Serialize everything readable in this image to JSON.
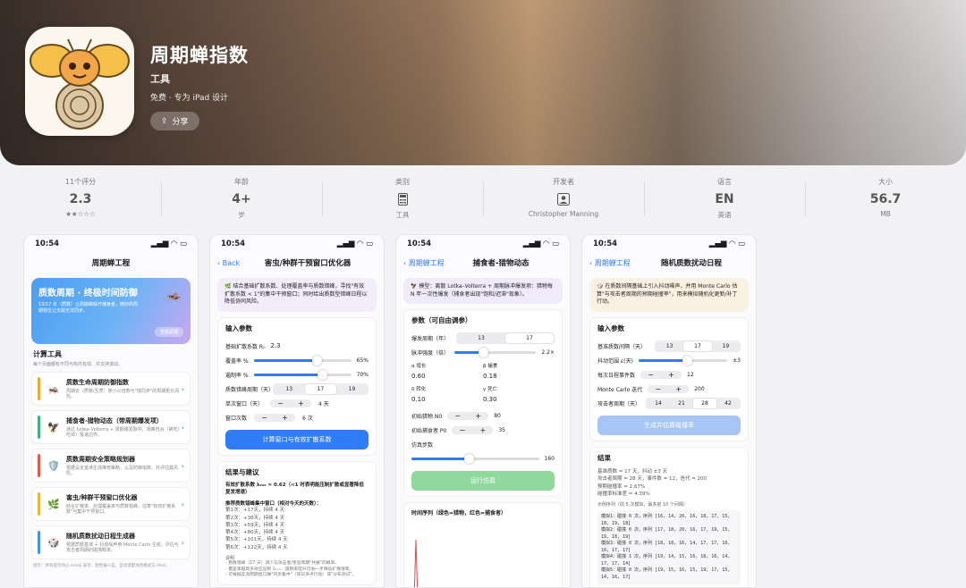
{
  "app": {
    "title": "周期蝉指数",
    "category": "工具",
    "subtitle": "免费 · 专为 iPad 设计",
    "share_label": "分享"
  },
  "stats": [
    {
      "label": "11个评分",
      "value": "2.3",
      "sub": "★★☆☆☆"
    },
    {
      "label": "年龄",
      "value": "4+",
      "sub": "岁"
    },
    {
      "label": "类别",
      "value": "",
      "sub": "工具",
      "icon": "calculator-icon"
    },
    {
      "label": "开发者",
      "value": "",
      "sub": "Christopher Manning",
      "icon": "person-icon"
    },
    {
      "label": "语言",
      "value": "EN",
      "sub": "英语"
    },
    {
      "label": "大小",
      "value": "56.7",
      "sub": "MB"
    }
  ],
  "screens": {
    "time": "10:54",
    "s1": {
      "nav_title": "周期蝉工程",
      "banner_title": "质数周期 · 终极时间防御",
      "banner_text": "13/17 年（质数）让周期蝉躲开捕食者，微妙的周期错位让天敌无法同步。",
      "banner_btn": "查看原理",
      "section": "计算工具",
      "section_sub": "每个页面都有不同与构件有效、并支持滚动。",
      "tools": [
        {
          "name": "质数生命周期防御指数",
          "desc": "周期长（质数/互质）使小公倍数与\"撞同步\"的周期更长风险。",
          "icon": "🦗",
          "color": "#f0a830"
        },
        {
          "name": "捕食者-猎物动态（带周期爆发项）",
          "desc": "通过 Lotka–Volterra + 周期爆发脉冲，观察低谷（被吃/吃掉）极速边界。",
          "icon": "🦅",
          "color": "#3fb37f"
        },
        {
          "name": "质数周期安全策略规划器",
          "desc": "根据设定基准生成推荐策略，以及防御指数、并评估其风险。",
          "icon": "🛡️",
          "color": "#e05a4a"
        },
        {
          "name": "害虫/种群干预窗口优化器",
          "desc": "结合扩散率、处理覆盖率与质数错峰，估算\"有效扩散系数\"与集中干预窗口。",
          "icon": "🌿",
          "color": "#e8b93a"
        },
        {
          "name": "随机质数扰动日程生成器",
          "desc": "根据质数基准 + 抖动噪声用 Monte Carlo 生成，评估与攻击者周期的碰撞概率。",
          "icon": "🎲",
          "color": "#4a90e2"
        }
      ],
      "footer": "提示：所有提示均以 emoji 表示，配色偏十蓝，自动适配浅色模式与 iPad。"
    },
    "s2": {
      "back": "Back",
      "nav_title": "害虫/种群干预窗口优化器",
      "note": "结合基础扩散系数、处理覆盖率与质数错峰，寻找\"有效扩散系数 < 1\"的集中干预窗口；同时给出质数型错峰日程以降低协同风险。",
      "input_hdr": "输入参数",
      "r0_label": "基础扩散系数 R₀",
      "r0_value": "2.3",
      "cover_label": "覆盖率 %",
      "cover_value": "65%",
      "cover_level": 0.65,
      "effect_label": "遏制率 %",
      "effect_value": "70%",
      "effect_level": 0.7,
      "period_label": "质数错峰周期（天）",
      "period_opts": [
        "13",
        "17",
        "19"
      ],
      "period_sel": 1,
      "window_label": "单次窗口（天）",
      "window_value": "4 天",
      "count_label": "窗口次数",
      "count_value": "6 次",
      "btn": "计算窗口与有效扩散系数",
      "result_hdr": "结果与建议",
      "result_main": "有效扩散系数 λₑₓₓ ≈ 0.62（<1 时表明能压制扩散或显著降低复发增速）",
      "result_sub": "推荐质数错峰集中窗口（相对今天的天数）：",
      "result_lines": [
        "第1次：+17天，持续 4 天",
        "第2次：+38天，持续 4 天",
        "第3次：+59天，持续 4 天",
        "第4次：+80天，持续 4 天",
        "第5次：+101天，持续 4 天",
        "第6次：+122天，持续 4 天"
      ],
      "explain_hdr": "说明",
      "explain": [
        "- 质数错峰（17 天）减少与攻击者/害虫周期\"共振\"的概率。",
        "- 覆盖率越高多效应压制 λₑₓₓ，遏制率提升可进一步降低扩散增率。",
        "- 可根据实测周期窗口做\"同步集中\"（同日多点行动）或\"分布测试\"。"
      ]
    },
    "s3": {
      "back": "周期蝉工程",
      "nav_title": "捕食者-猎物动态",
      "note": "模型：离散 Lotka–Volterra + 周期脉冲爆发项：猎物每 N 年一次性爆发（捕食者出现\"饱和/迟滞\"现象）。",
      "param_hdr": "参数（可自由调参）",
      "burst_label": "爆发周期（年）",
      "burst_opts": [
        "13",
        "17"
      ],
      "burst_sel": 1,
      "pulse_label": "脉冲强度（倍）",
      "pulse_value": "2.2×",
      "pulse_level": 0.35,
      "alpha_label": "α 增长",
      "alpha_value": "0.60",
      "beta_label": "β 捕食",
      "beta_value": "0.18",
      "delta_label": "δ 转化",
      "delta_value": "0.10",
      "gamma_label": "γ 死亡",
      "gamma_value": "0.30",
      "prey_label": "初始猎物 N0",
      "prey_value": "80",
      "pred_label": "初始捕食者 P0",
      "pred_value": "35",
      "steps_label": "仿真步数",
      "steps_value": "160",
      "steps_level": 0.45,
      "btn": "运行仿真",
      "chart_hdr": "时间序列（绿色=猎物，红色=捕食者）"
    },
    "s4": {
      "back": "周期蝉工程",
      "nav_title": "随机质数扰动日程",
      "note": "在质数间隔基础上引入抖动噪声，并用 Monte Carlo 估算\"与攻击者周期的预期碰撞率\"，用来模拟随机化更新/补丁行动。",
      "input_hdr": "输入参数",
      "base_label": "基准质数间隔（天）",
      "base_opts": [
        "13",
        "17",
        "19"
      ],
      "base_sel": 1,
      "jitter_label": "抖动范围 ε(天)",
      "jitter_value": "±3",
      "jitter_level": 0.55,
      "events_label": "每次日程事件数",
      "events_value": "12",
      "mc_label": "Monte Carlo 迭代",
      "mc_value": "200",
      "attack_label": "攻击者周期（天）",
      "attack_opts": [
        "14",
        "21",
        "28",
        "42"
      ],
      "attack_sel": 2,
      "btn": "生成并估算碰撞率",
      "result_hdr": "结果",
      "result_lines": [
        "基准质数 = 17 天，抖动 ±3 天",
        "攻击者周期 = 28 天，事件数 = 12，迭代 = 200",
        "预期碰撞率 = 2.67%",
        "碰撞率标准差 = 4.39%"
      ],
      "sample_hdr": "示例序列（前 5 次模拟，最多前 10 个间隔）",
      "samples": [
        "模拟1：碰撞 0 次，序列 [16, 14, 20, 16, 18, 17, 15, 18, 19, 18]",
        "模拟2：碰撞 0 次，序列 [17, 18, 20, 16, 17, 19, 15, 19, 18, 19]",
        "模拟3：碰撞 0 次，序列 [18, 18, 16, 14, 17, 17, 16, 16, 17, 17]",
        "模拟4：碰撞 1 次，序列 [19, 14, 15, 16, 18, 16, 14, 17, 17, 14]",
        "模拟5：碰撞 0 次，序列 [19, 15, 16, 15, 19, 17, 15, 14, 16, 17]"
      ]
    }
  }
}
